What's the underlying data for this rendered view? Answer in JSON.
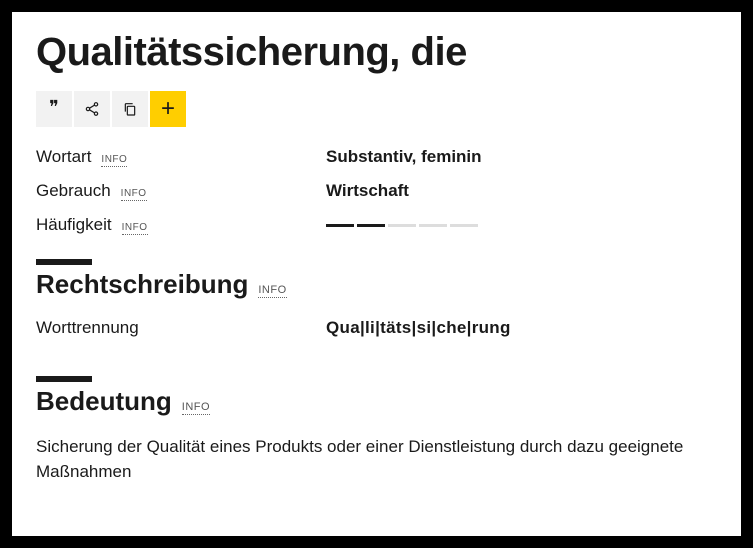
{
  "headword": "Qualitätssicherung, die",
  "info_label": "INFO",
  "properties": {
    "wortart": {
      "label": "Wortart",
      "value": "Substantiv, feminin"
    },
    "gebrauch": {
      "label": "Gebrauch",
      "value": "Wirtschaft"
    },
    "haeufigkeit": {
      "label": "Häufigkeit",
      "level": 2,
      "max": 5
    }
  },
  "sections": {
    "rechtschreibung": {
      "title": "Rechtschreibung",
      "worttrennung_label": "Worttrennung",
      "worttrennung_value": "Qua|li|täts|si|che|rung"
    },
    "bedeutung": {
      "title": "Bedeutung",
      "text": "Sicherung der Qualität eines Produkts oder einer Dienstleistung durch dazu geeignete Maßnahmen"
    }
  }
}
